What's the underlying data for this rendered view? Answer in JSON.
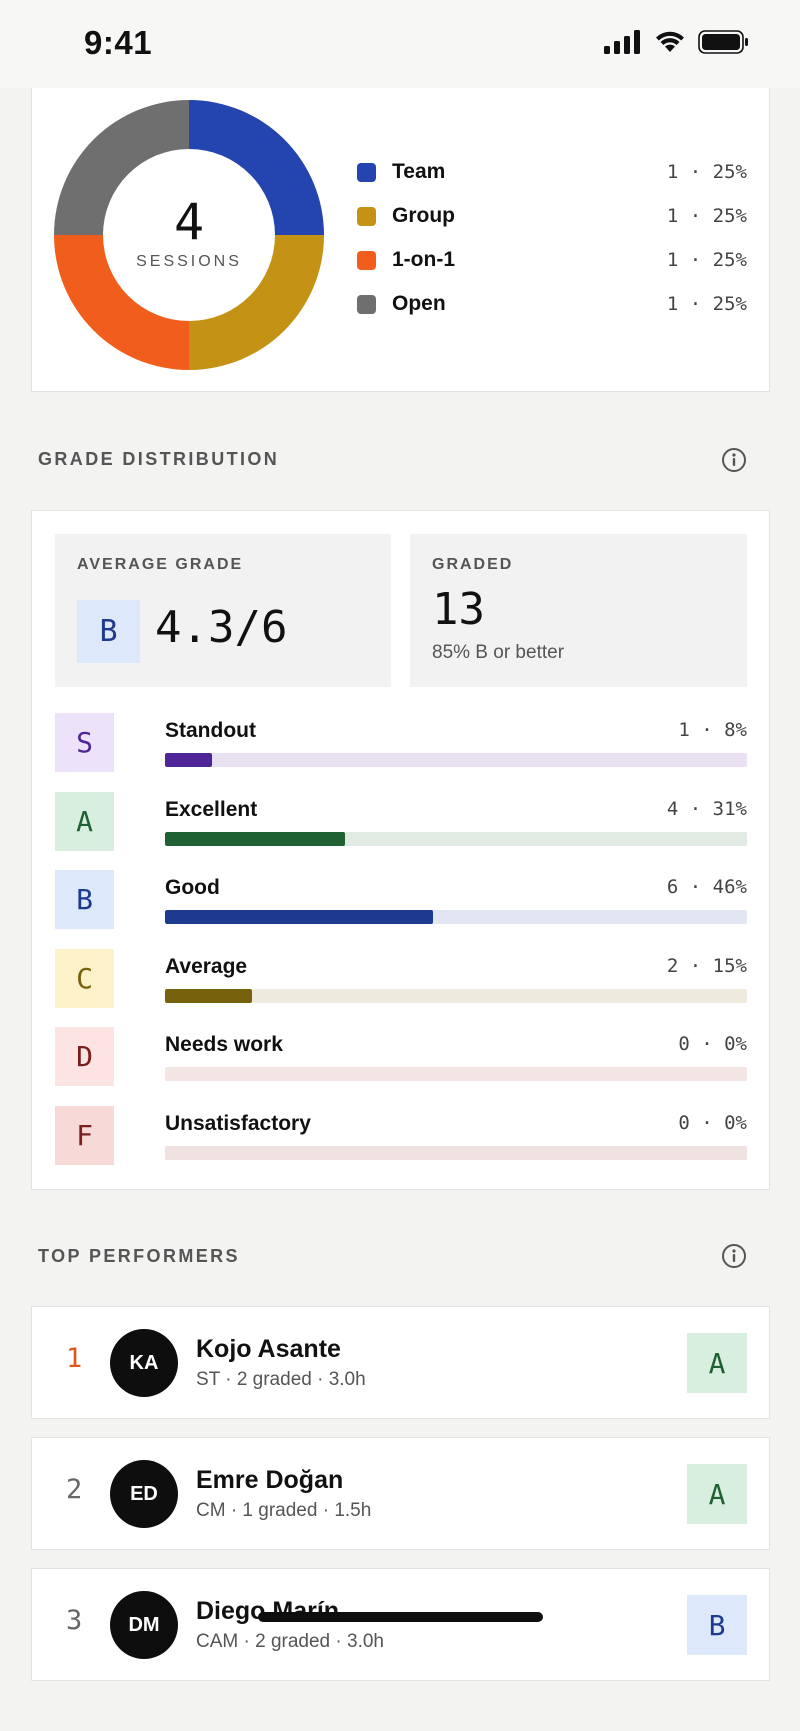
{
  "status_bar": {
    "time": "9:41"
  },
  "sessions": {
    "total": "4",
    "total_label": "SESSIONS",
    "legend": [
      {
        "name": "Team",
        "value": "1 · 25%",
        "color": "#2444b0",
        "share": 25
      },
      {
        "name": "Group",
        "value": "1 · 25%",
        "color": "#c49214",
        "share": 25
      },
      {
        "name": "1-on-1",
        "value": "1 · 25%",
        "color": "#f15d1c",
        "share": 25
      },
      {
        "name": "Open",
        "value": "1 · 25%",
        "color": "#6f6f6f",
        "share": 25
      }
    ]
  },
  "grade_distribution": {
    "title": "GRADE DISTRIBUTION",
    "average_label": "AVERAGE GRADE",
    "average_letter": "B",
    "average_value": "4.3/6",
    "graded_label": "GRADED",
    "graded_value": "13",
    "graded_sub": "85% B or better",
    "grades": [
      {
        "letter": "S",
        "name": "Standout",
        "value": "1 · 8%",
        "percent": 8,
        "fill": "#4d2596",
        "track": "#e9e1f1",
        "badge_bg": "#ece3fb",
        "badge_fg": "#4d2596"
      },
      {
        "letter": "A",
        "name": "Excellent",
        "value": "4 · 31%",
        "percent": 31,
        "fill": "#1f6132",
        "track": "#e1ebe4",
        "badge_bg": "#d8efdf",
        "badge_fg": "#1f6132"
      },
      {
        "letter": "B",
        "name": "Good",
        "value": "6 · 46%",
        "percent": 46,
        "fill": "#1e3a8e",
        "track": "#e2e6f2",
        "badge_bg": "#dde8fb",
        "badge_fg": "#1e3a8e"
      },
      {
        "letter": "C",
        "name": "Average",
        "value": "2 · 15%",
        "percent": 15,
        "fill": "#77610d",
        "track": "#eeeade",
        "badge_bg": "#fcf1c9",
        "badge_fg": "#77610d"
      },
      {
        "letter": "D",
        "name": "Needs work",
        "value": "0 · 0%",
        "percent": 0,
        "fill": "#7a1e1e",
        "track": "#f3e5e4",
        "badge_bg": "#fce4e2",
        "badge_fg": "#7a1e1e"
      },
      {
        "letter": "F",
        "name": "Unsatisfactory",
        "value": "0 · 0%",
        "percent": 0,
        "fill": "#7a1e1e",
        "track": "#efe2e0",
        "badge_bg": "#f7dad8",
        "badge_fg": "#7a1e1e"
      }
    ]
  },
  "top_performers": {
    "title": "TOP PERFORMERS",
    "items": [
      {
        "rank": "1",
        "initials": "KA",
        "name": "Kojo Asante",
        "meta": "ST · 2 graded · 3.0h",
        "grade": "A",
        "badge_bg": "#d8efdf",
        "badge_fg": "#1f6132"
      },
      {
        "rank": "2",
        "initials": "ED",
        "name": "Emre Doğan",
        "meta": "CM · 1 graded · 1.5h",
        "grade": "A",
        "badge_bg": "#d8efdf",
        "badge_fg": "#1f6132"
      },
      {
        "rank": "3",
        "initials": "DM",
        "name": "Diego Marín",
        "meta": "CAM · 2 graded · 3.0h",
        "grade": "B",
        "badge_bg": "#dde8fb",
        "badge_fg": "#1e3a8e"
      }
    ]
  }
}
